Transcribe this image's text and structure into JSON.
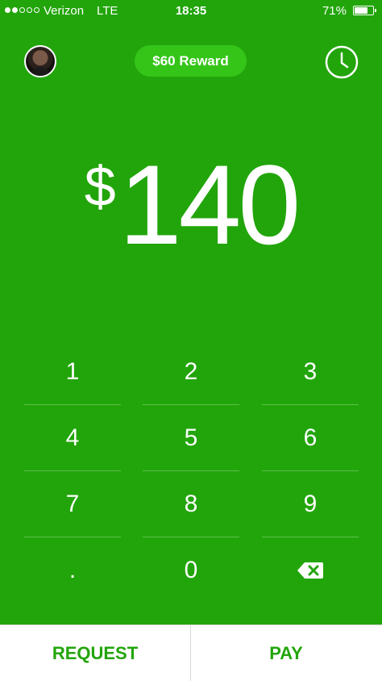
{
  "status_bar": {
    "carrier": "Verizon",
    "network": "LTE",
    "time": "18:35",
    "battery": "71%",
    "battery_level": 0.71
  },
  "header": {
    "reward_label": "$60 Reward",
    "avatar_icon": "user-avatar",
    "history_icon": "clock-icon"
  },
  "amount": {
    "currency": "$",
    "value": "140"
  },
  "keypad": {
    "rows": [
      [
        "1",
        "2",
        "3"
      ],
      [
        "4",
        "5",
        "6"
      ],
      [
        "7",
        "8",
        "9"
      ],
      [
        ".",
        "0",
        "backspace-icon"
      ]
    ]
  },
  "actions": {
    "request_label": "REQUEST",
    "pay_label": "PAY"
  },
  "colors": {
    "brand_green": "#22a50b",
    "reward_pill": "#35c519",
    "action_text": "#22a50b"
  }
}
